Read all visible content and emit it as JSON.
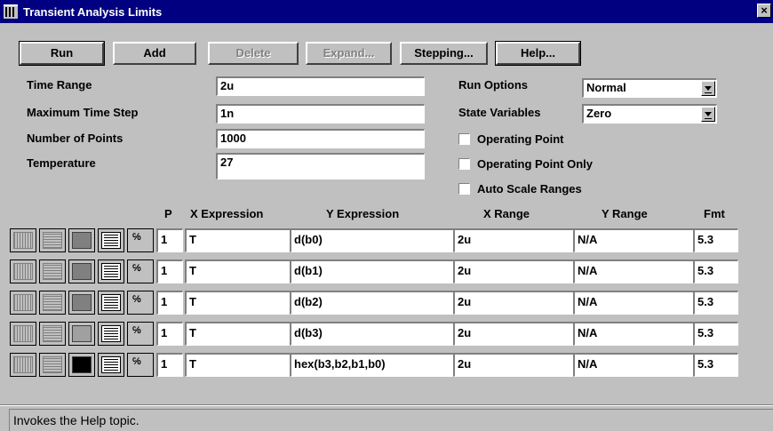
{
  "window": {
    "title": "Transient Analysis Limits",
    "close_label": "×"
  },
  "toolbar": {
    "run": "Run",
    "add": "Add",
    "delete": "Delete",
    "expand": "Expand...",
    "stepping": "Stepping...",
    "help": "Help..."
  },
  "params": {
    "time_range_label": "Time Range",
    "time_range_value": "2u",
    "max_step_label": "Maximum Time Step",
    "max_step_value": "1n",
    "num_points_label": "Number of Points",
    "num_points_value": "1000",
    "temperature_label": "Temperature",
    "temperature_value": "27"
  },
  "options": {
    "run_options_label": "Run Options",
    "run_options_value": "Normal",
    "state_vars_label": "State Variables",
    "state_vars_value": "Zero",
    "operating_point": "Operating Point",
    "operating_point_only": "Operating Point Only",
    "auto_scale": "Auto Scale Ranges"
  },
  "columns": {
    "p": "P",
    "x_expr": "X Expression",
    "y_expr": "Y Expression",
    "x_range": "X Range",
    "y_range": "Y Range",
    "fmt": "Fmt"
  },
  "rows": [
    {
      "p": "1",
      "x": "T",
      "y": "d(b0)",
      "xr": "2u",
      "yr": "N/A",
      "fmt": "5.3",
      "color": "#808080"
    },
    {
      "p": "1",
      "x": "T",
      "y": "d(b1)",
      "xr": "2u",
      "yr": "N/A",
      "fmt": "5.3",
      "color": "#808080"
    },
    {
      "p": "1",
      "x": "T",
      "y": "d(b2)",
      "xr": "2u",
      "yr": "N/A",
      "fmt": "5.3",
      "color": "#808080"
    },
    {
      "p": "1",
      "x": "T",
      "y": "d(b3)",
      "xr": "2u",
      "yr": "N/A",
      "fmt": "5.3",
      "color": "#a0a0a0"
    },
    {
      "p": "1",
      "x": "T",
      "y": "hex(b3,b2,b1,b0)",
      "xr": "2u",
      "yr": "N/A",
      "fmt": "5.3",
      "color": "#000000"
    }
  ],
  "status": "Invokes the Help topic."
}
